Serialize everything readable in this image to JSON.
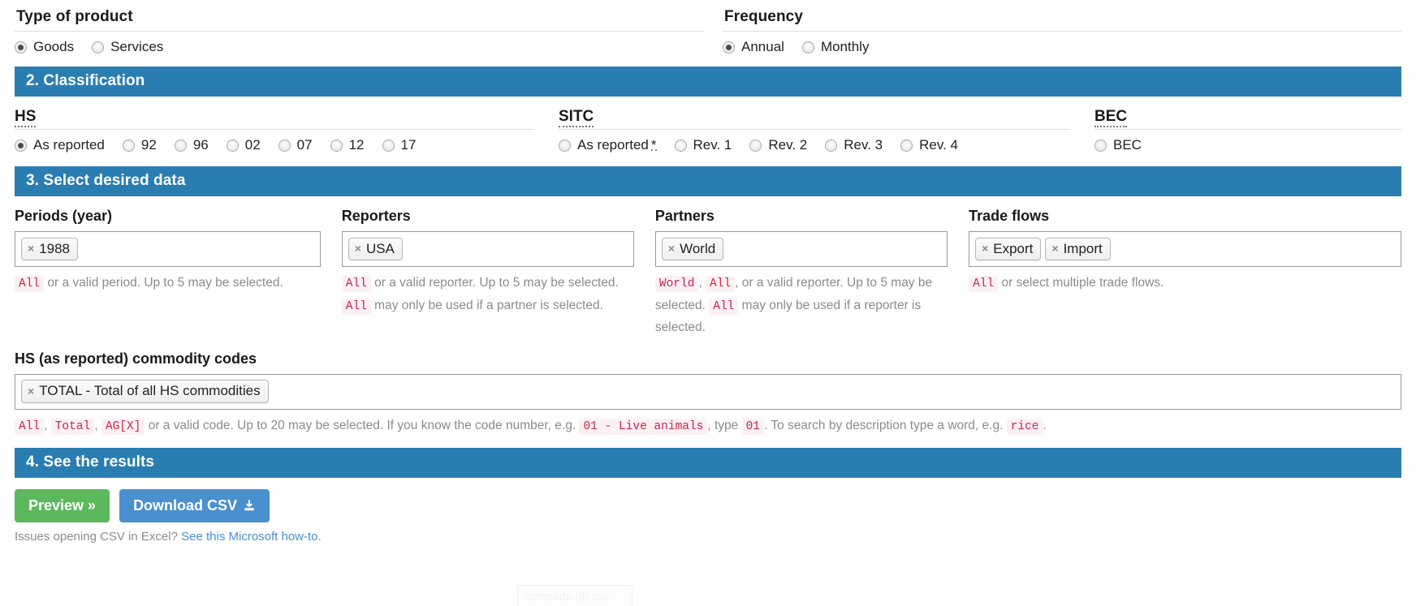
{
  "type_of_product": {
    "title": "Type of product",
    "options": [
      {
        "label": "Goods",
        "checked": true
      },
      {
        "label": "Services",
        "checked": false
      }
    ]
  },
  "frequency": {
    "title": "Frequency",
    "options": [
      {
        "label": "Annual",
        "checked": true
      },
      {
        "label": "Monthly",
        "checked": false
      }
    ]
  },
  "section_classification": {
    "bar_title": "2. Classification",
    "hs": {
      "label": "HS",
      "options": [
        {
          "label": "As reported",
          "checked": true
        },
        {
          "label": "92",
          "checked": false
        },
        {
          "label": "96",
          "checked": false
        },
        {
          "label": "02",
          "checked": false
        },
        {
          "label": "07",
          "checked": false
        },
        {
          "label": "12",
          "checked": false
        },
        {
          "label": "17",
          "checked": false
        }
      ]
    },
    "sitc": {
      "label": "SITC",
      "options": [
        {
          "label": "As reported",
          "checked": false,
          "asterisk": "*"
        },
        {
          "label": "Rev. 1",
          "checked": false
        },
        {
          "label": "Rev. 2",
          "checked": false
        },
        {
          "label": "Rev. 3",
          "checked": false
        },
        {
          "label": "Rev. 4",
          "checked": false
        }
      ]
    },
    "bec": {
      "label": "BEC",
      "options": [
        {
          "label": "BEC",
          "checked": false
        }
      ]
    }
  },
  "section_select_data": {
    "bar_title": "3. Select desired data",
    "periods": {
      "label": "Periods (year)",
      "tokens": [
        "1988"
      ],
      "help": [
        {
          "t": "code",
          "v": "All"
        },
        {
          "t": "text",
          "v": " or a valid period. Up to 5 may be selected."
        }
      ]
    },
    "reporters": {
      "label": "Reporters",
      "tokens": [
        "USA"
      ],
      "help": [
        {
          "t": "code",
          "v": "All"
        },
        {
          "t": "text",
          "v": " or a valid reporter. Up to 5 may be selected. "
        },
        {
          "t": "code",
          "v": "All"
        },
        {
          "t": "text",
          "v": " may only be used if a partner is selected."
        }
      ]
    },
    "partners": {
      "label": "Partners",
      "tokens": [
        "World"
      ],
      "help": [
        {
          "t": "code",
          "v": "World"
        },
        {
          "t": "text",
          "v": ", "
        },
        {
          "t": "code",
          "v": "All"
        },
        {
          "t": "text",
          "v": ", or a valid reporter. Up to 5 may be selected. "
        },
        {
          "t": "code",
          "v": "All"
        },
        {
          "t": "text",
          "v": " may only be used if a reporter is selected."
        }
      ]
    },
    "trade_flows": {
      "label": "Trade flows",
      "tokens": [
        "Export",
        "Import"
      ],
      "help": [
        {
          "t": "code",
          "v": "All"
        },
        {
          "t": "text",
          "v": " or select multiple trade flows."
        }
      ]
    },
    "commodity_codes": {
      "label": "HS (as reported) commodity codes",
      "tokens": [
        "TOTAL - Total of all HS commodities"
      ],
      "help": [
        {
          "t": "code",
          "v": "All"
        },
        {
          "t": "text",
          "v": ", "
        },
        {
          "t": "code",
          "v": "Total"
        },
        {
          "t": "text",
          "v": ", "
        },
        {
          "t": "code",
          "v": "AG[X]"
        },
        {
          "t": "text",
          "v": " or a valid code. Up to 20 may be selected. If you know the code number, e.g. "
        },
        {
          "t": "code",
          "v": "01 - Live animals"
        },
        {
          "t": "text",
          "v": ", type "
        },
        {
          "t": "code",
          "v": "01"
        },
        {
          "t": "text",
          "v": ". To search by description type a word, e.g. "
        },
        {
          "t": "code",
          "v": "rice"
        },
        {
          "t": "text",
          "v": "."
        }
      ]
    }
  },
  "section_results": {
    "bar_title": "4. See the results",
    "preview_button": "Preview »",
    "download_button": "Download CSV",
    "download_icon": "download-icon",
    "note_text": "Issues opening CSV in Excel? ",
    "note_link": "See this Microsoft how-to.",
    "token_remove_icon": "×"
  },
  "download_bar": {
    "filename": "comtrade (9).csv"
  },
  "colors": {
    "section_bar": "#2a7db1",
    "preview_green": "#5cb85c",
    "download_blue": "#4a90cd",
    "code_pink": "#c7254e",
    "code_bg": "#fdf0f3",
    "help_gray": "#8b8b8b"
  }
}
